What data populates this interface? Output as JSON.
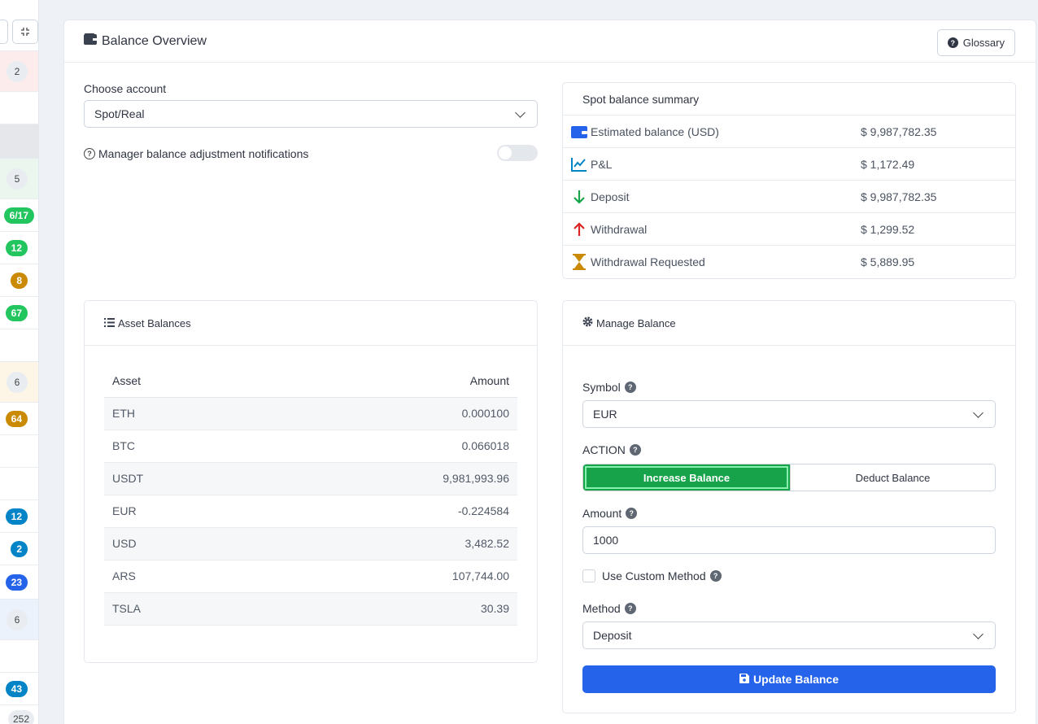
{
  "sidebar": {
    "badges": [
      "2",
      "5",
      "6/17",
      "12",
      "8",
      "67",
      "6",
      "64",
      "12",
      "2",
      "23",
      "6",
      "43",
      "252"
    ]
  },
  "header": {
    "title": "Balance Overview",
    "glossary_label": "Glossary"
  },
  "account": {
    "label": "Choose account",
    "selected": "Spot/Real",
    "notifications_label": "Manager balance adjustment notifications",
    "notifications_enabled": false
  },
  "summary": {
    "title": "Spot balance summary",
    "rows": [
      {
        "label": "Estimated balance (USD)",
        "value": "$ 9,987,782.35",
        "icon": "wallet-icon"
      },
      {
        "label": "P&L",
        "value": "$ 1,172.49",
        "icon": "chart-line-icon"
      },
      {
        "label": "Deposit",
        "value": "$ 9,987,782.35",
        "icon": "arrow-down-icon"
      },
      {
        "label": "Withdrawal",
        "value": "$ 1,299.52",
        "icon": "arrow-up-icon"
      },
      {
        "label": "Withdrawal Requested",
        "value": "$ 5,889.95",
        "icon": "hourglass-icon"
      }
    ]
  },
  "assets": {
    "title": "Asset Balances",
    "headers": [
      "Asset",
      "Amount"
    ],
    "rows": [
      {
        "asset": "ETH",
        "amount": "0.000100"
      },
      {
        "asset": "BTC",
        "amount": "0.066018"
      },
      {
        "asset": "USDT",
        "amount": "9,981,993.96"
      },
      {
        "asset": "EUR",
        "amount": "-0.224584"
      },
      {
        "asset": "USD",
        "amount": "3,482.52"
      },
      {
        "asset": "ARS",
        "amount": "107,744.00"
      },
      {
        "asset": "TSLA",
        "amount": "30.39"
      }
    ]
  },
  "manage": {
    "title": "Manage Balance",
    "symbol_label": "Symbol",
    "symbol_value": "EUR",
    "action_label": "ACTION",
    "increase_label": "Increase Balance",
    "deduct_label": "Deduct Balance",
    "amount_label": "Amount",
    "amount_value": "1000",
    "custom_method_label": "Use Custom Method",
    "method_label": "Method",
    "method_value": "Deposit",
    "update_label": "Update Balance"
  },
  "colors": {
    "primary": "#2563eb",
    "success": "#16a34a",
    "danger": "#dc2626",
    "warning": "#ca8a04"
  }
}
